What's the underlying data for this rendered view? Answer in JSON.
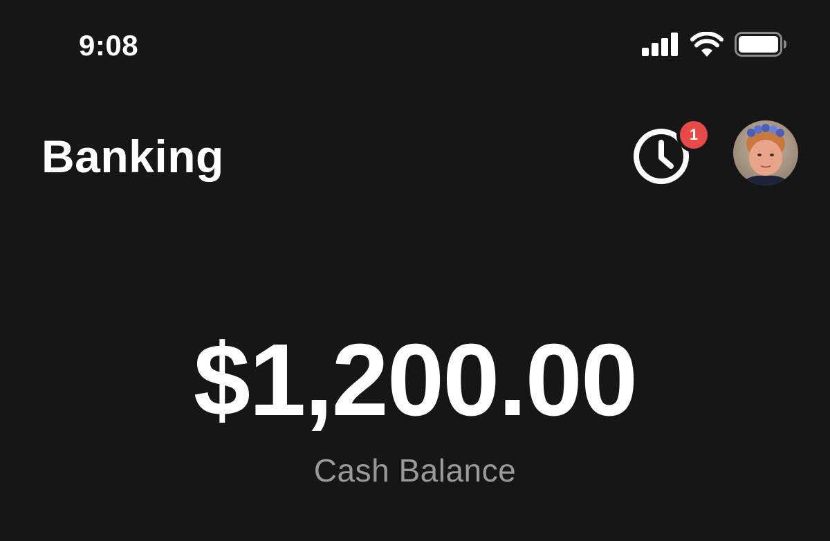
{
  "status_bar": {
    "time": "9:08",
    "icons": [
      "cellular-signal-icon",
      "wifi-icon",
      "battery-icon"
    ]
  },
  "header": {
    "title": "Banking",
    "activity_icon": "clock-icon",
    "notification_count": "1",
    "avatar_icon": "profile-avatar"
  },
  "balance": {
    "amount": "$1,200.00",
    "label": "Cash Balance"
  },
  "colors": {
    "background": "#161617",
    "text_primary": "#ffffff",
    "text_secondary": "#9a9a9c",
    "badge": "#e84a4a"
  }
}
